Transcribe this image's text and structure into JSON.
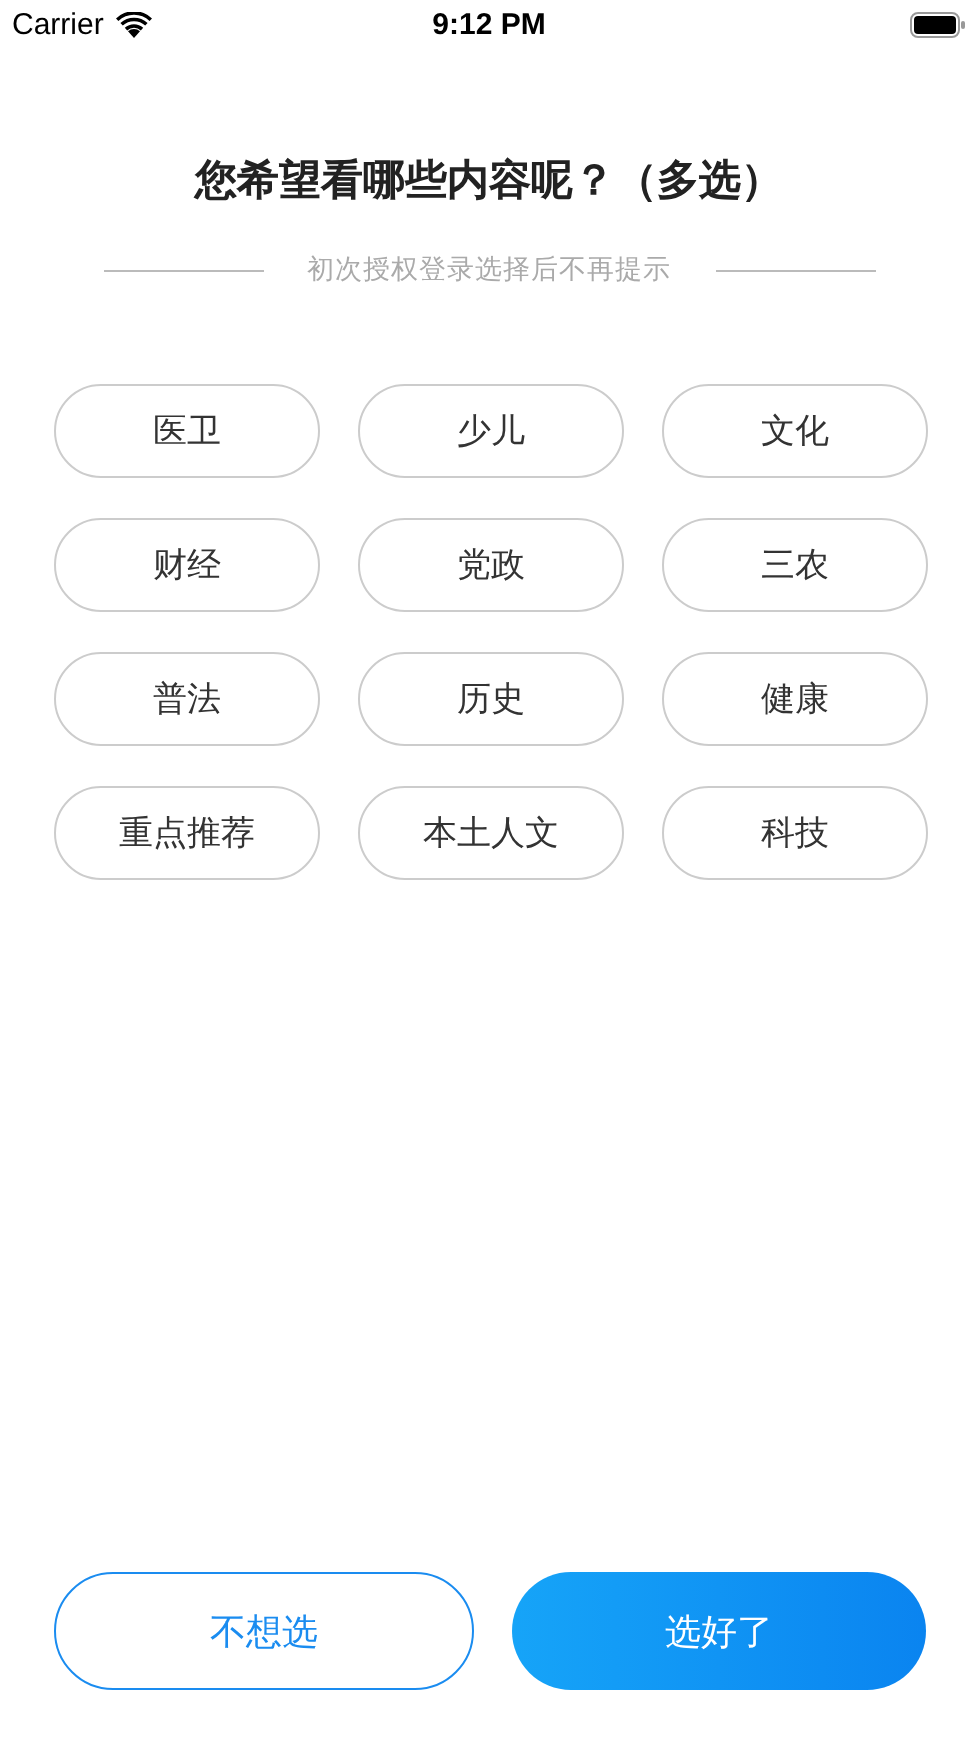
{
  "status_bar": {
    "carrier": "Carrier",
    "time": "9:12 PM"
  },
  "title": "您希望看哪些内容呢？（多选）",
  "subtitle": "初次授权登录选择后不再提示",
  "topics": [
    {
      "label": "医卫",
      "selected": false
    },
    {
      "label": "少儿",
      "selected": false
    },
    {
      "label": "文化",
      "selected": false
    },
    {
      "label": "财经",
      "selected": false
    },
    {
      "label": "党政",
      "selected": false
    },
    {
      "label": "三农",
      "selected": false
    },
    {
      "label": "普法",
      "selected": false
    },
    {
      "label": "历史",
      "selected": false
    },
    {
      "label": "健康",
      "selected": false
    },
    {
      "label": "重点推荐",
      "selected": false
    },
    {
      "label": "本土人文",
      "selected": false
    },
    {
      "label": "科技",
      "selected": false
    }
  ],
  "buttons": [
    {
      "label": "不想选",
      "kind": "secondary"
    },
    {
      "label": "选好了",
      "kind": "primary"
    }
  ]
}
